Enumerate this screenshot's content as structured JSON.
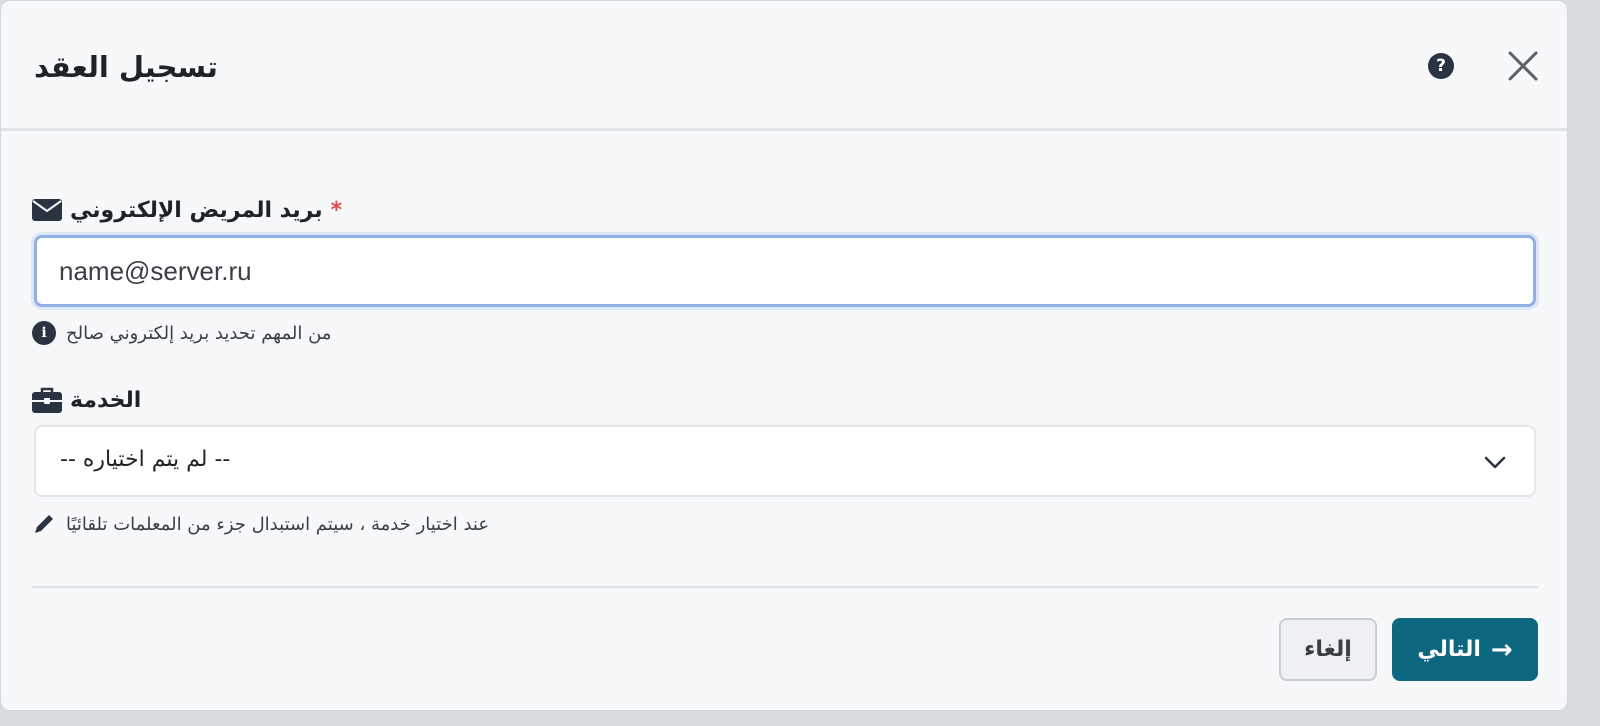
{
  "dialog": {
    "title": "تسجيل العقد",
    "help_symbol": "?"
  },
  "email_field": {
    "label": "بريد المريض الإلكتروني",
    "required_mark": "*",
    "value": "name@server.ru",
    "hint": "من المهم تحديد بريد إلكتروني صالح",
    "info_symbol": "i"
  },
  "service_field": {
    "label": "الخدمة",
    "selected": "-- لم يتم اختياره --",
    "hint": "عند اختيار خدمة ، سيتم استبدال جزء من المعلمات تلقائيًا"
  },
  "footer": {
    "cancel_label": "إلغاء",
    "next_label": "التالي",
    "next_arrow": "→"
  },
  "colors": {
    "primary": "#0e6780",
    "required": "#e5484d",
    "focus_border": "#8fb1e6"
  },
  "icons": {
    "help": "help-circle-icon",
    "close": "close-icon",
    "email": "envelope-icon",
    "info": "info-circle-icon",
    "service": "briefcase-icon",
    "chevron": "chevron-down-icon",
    "hint_edit": "pencil-icon",
    "next": "arrow-right-icon"
  }
}
